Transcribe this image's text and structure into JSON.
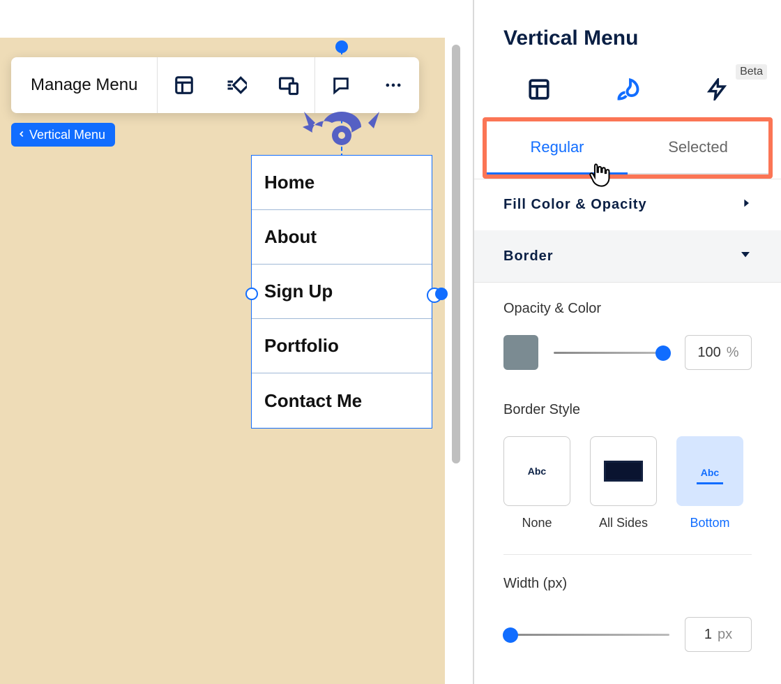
{
  "panel": {
    "title": "Vertical Menu",
    "beta_badge": "Beta",
    "state_tabs": {
      "regular": "Regular",
      "selected": "Selected"
    },
    "sections": {
      "fill": "Fill Color & Opacity",
      "border": "Border"
    },
    "border": {
      "opacity_label": "Opacity & Color",
      "opacity_value": "100",
      "opacity_unit": "%",
      "swatch_color": "#7b8b92",
      "style_label": "Border Style",
      "styles": {
        "none": "None",
        "all": "All Sides",
        "bottom": "Bottom"
      },
      "abc": "Abc",
      "width_label": "Width (px)",
      "width_value": "1",
      "width_unit": "px"
    }
  },
  "toolbar": {
    "manage": "Manage Menu",
    "breadcrumb": "Vertical Menu"
  },
  "menu_items": {
    "0": "Home",
    "1": "About",
    "2": "Sign Up",
    "3": "Portfolio",
    "4": "Contact Me"
  }
}
